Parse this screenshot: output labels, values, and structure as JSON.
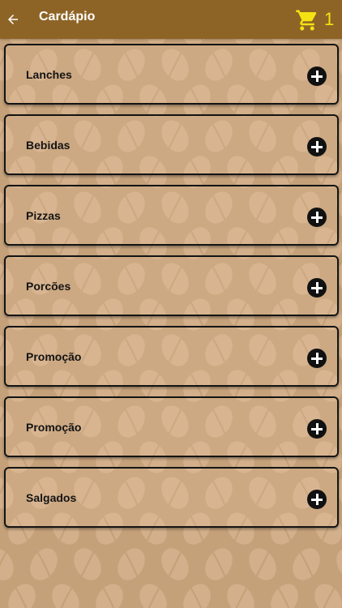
{
  "colors": {
    "appbar": "#8e6426",
    "background": "#c5a17a",
    "cart": "#f5e212",
    "card_border": "#141414",
    "plus_icon": "#111111"
  },
  "appbar": {
    "title": "Cardápio",
    "back_icon": "arrow-left-icon",
    "cart_icon": "shopping-cart-icon",
    "cart_count": "1"
  },
  "categories": [
    {
      "label": "Lanches",
      "action_icon": "plus-circle-icon"
    },
    {
      "label": "Bebidas",
      "action_icon": "plus-circle-icon"
    },
    {
      "label": "Pizzas",
      "action_icon": "plus-circle-icon"
    },
    {
      "label": "Porcões",
      "action_icon": "plus-circle-icon"
    },
    {
      "label": "Promoção",
      "action_icon": "plus-circle-icon"
    },
    {
      "label": "Promoção",
      "action_icon": "plus-circle-icon"
    },
    {
      "label": "Salgados",
      "action_icon": "plus-circle-icon"
    }
  ]
}
